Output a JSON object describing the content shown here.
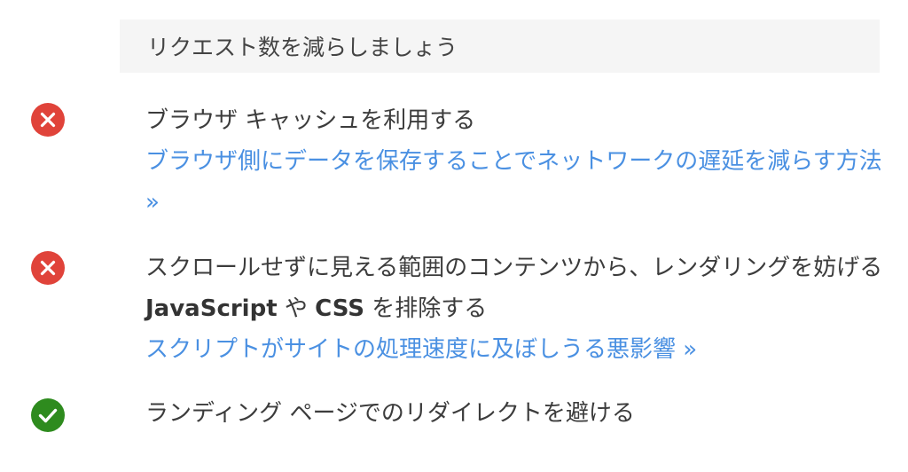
{
  "section": {
    "title": "リクエスト数を減らしましょう"
  },
  "items": [
    {
      "status": "fail",
      "icon": "error-x-icon",
      "title": "ブラウザ キャッシュを利用する",
      "link": "ブラウザ側にデータを保存することでネットワークの遅延を減らす方法 »"
    },
    {
      "status": "fail",
      "icon": "error-x-icon",
      "title_parts": [
        "スクロールせずに見える範囲のコンテンツから、レンダリングを妨げる ",
        "JavaScript",
        " や ",
        "CSS",
        " を排除する"
      ],
      "link": "スクリプトがサイトの処理速度に及ぼしうる悪影響 »"
    },
    {
      "status": "pass",
      "icon": "checkmark-icon",
      "title": "ランディング ページでのリダイレクトを避ける"
    }
  ],
  "colors": {
    "fail": "#e0433a",
    "pass": "#2e8b1e",
    "link": "#4a90e2",
    "header_bg": "#f5f5f5"
  }
}
